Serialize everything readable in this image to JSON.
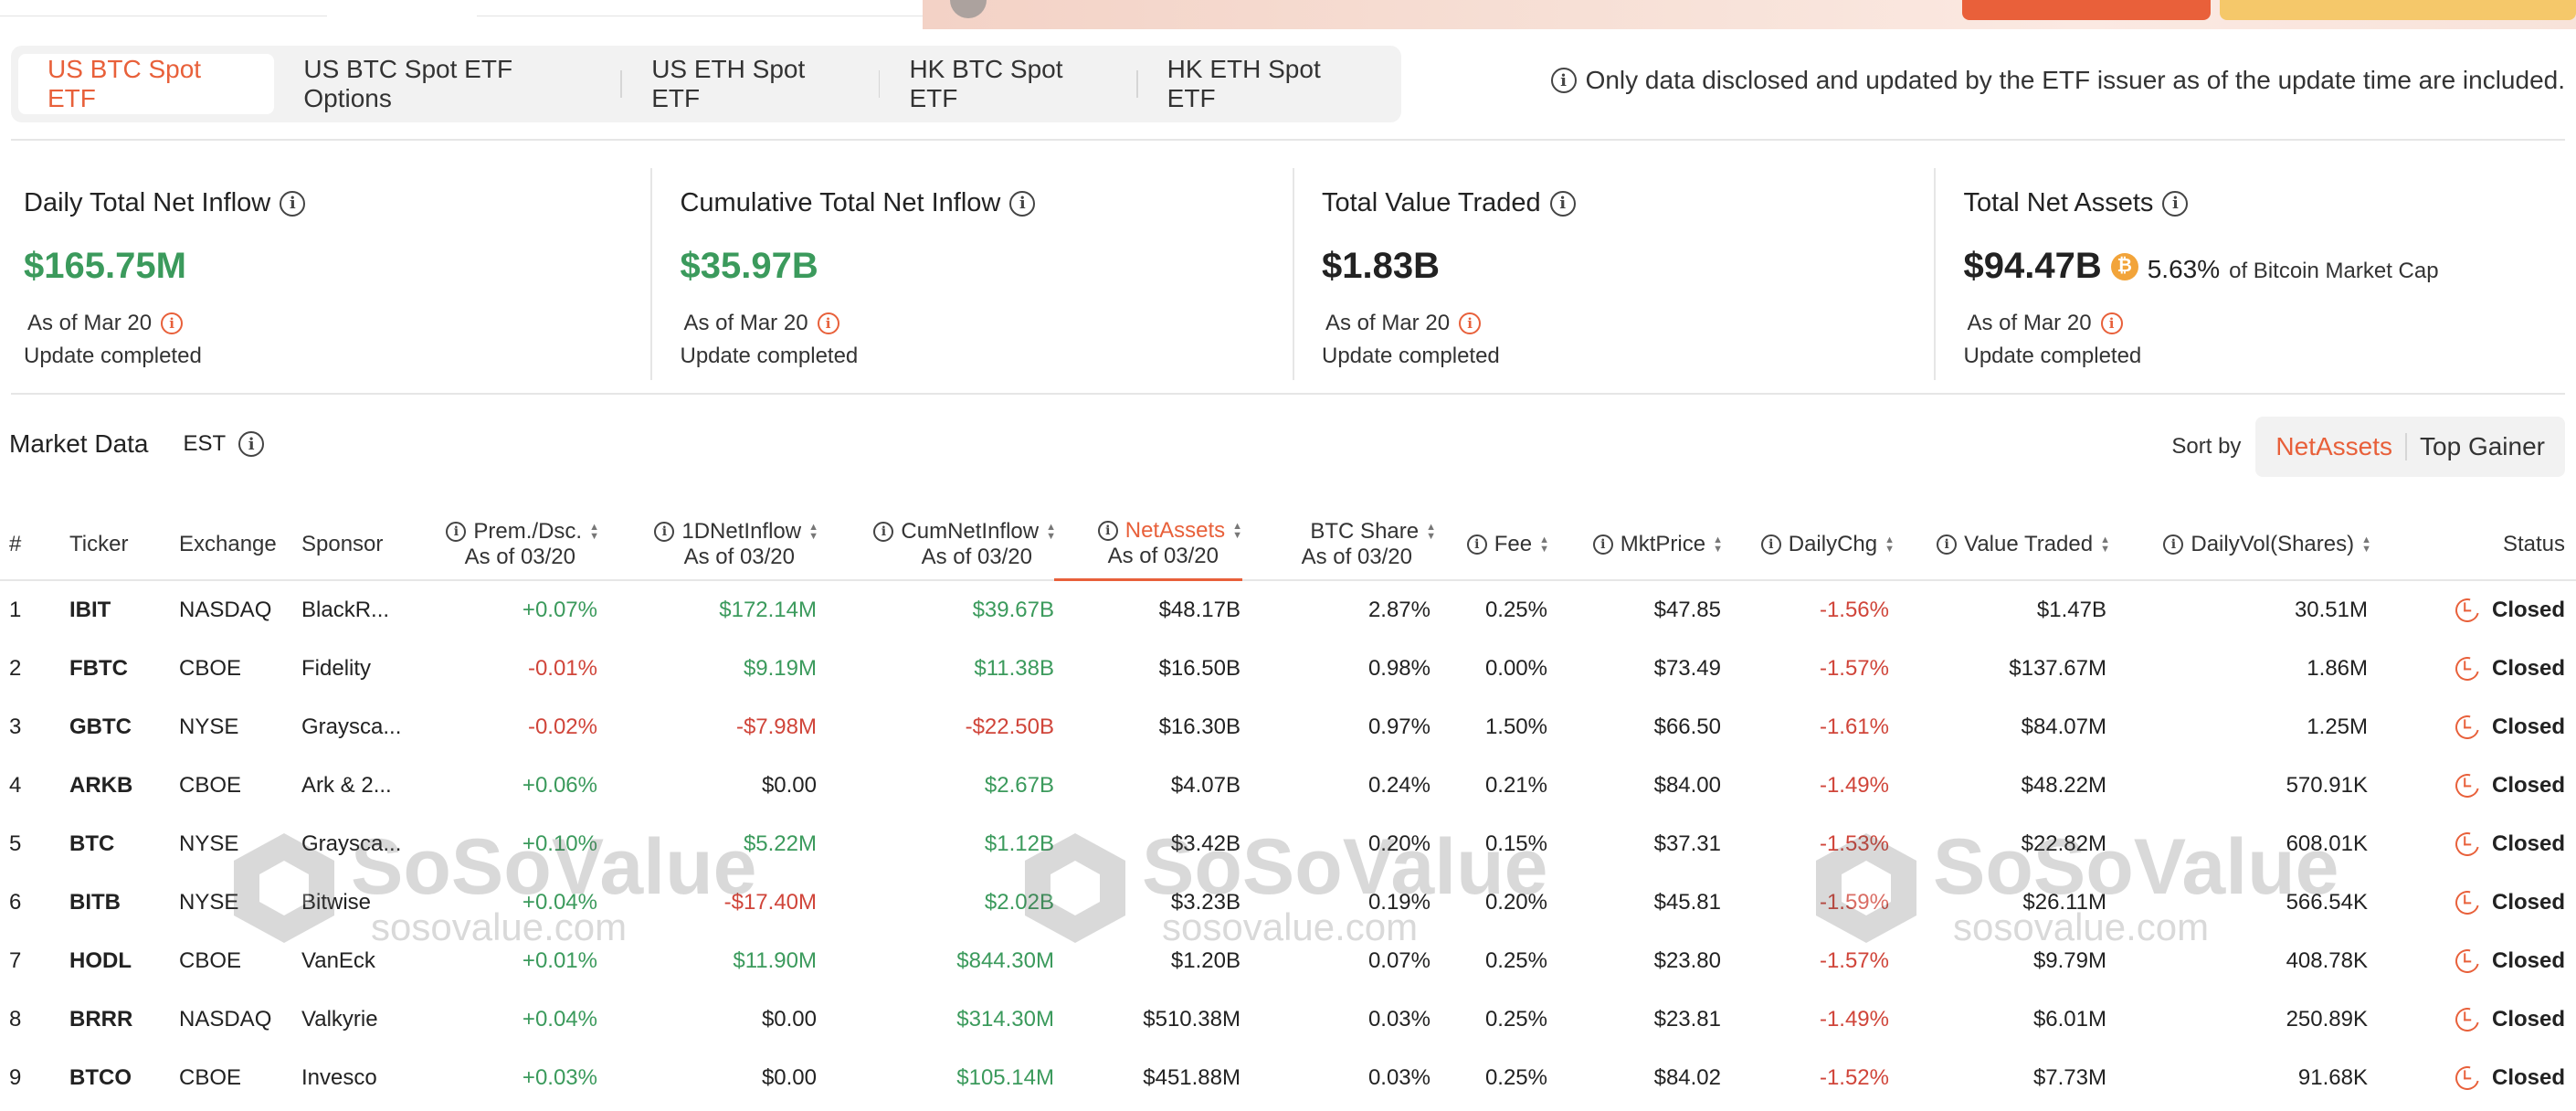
{
  "tabs": [
    {
      "label": "US BTC Spot ETF",
      "active": true
    },
    {
      "label": "US BTC Spot ETF Options",
      "active": false
    },
    {
      "label": "US ETH Spot ETF",
      "active": false
    },
    {
      "label": "HK BTC Spot ETF",
      "active": false
    },
    {
      "label": "HK ETH Spot ETF",
      "active": false
    }
  ],
  "notice": "Only data disclosed and updated by the ETF issuer as of the update time are included.",
  "cards": [
    {
      "label": "Daily Total Net Inflow",
      "value": "$165.75M",
      "asof": "As of Mar 20",
      "status": "Update completed"
    },
    {
      "label": "Cumulative Total Net Inflow",
      "value": "$35.97B",
      "asof": "As of Mar 20",
      "status": "Update completed"
    },
    {
      "label": "Total Value Traded",
      "value": "$1.83B",
      "asof": "As of Mar 20",
      "status": "Update completed"
    },
    {
      "label": "Total Net Assets",
      "value": "$94.47B",
      "pct": "5.63%",
      "pct_label": "of Bitcoin Market Cap",
      "asof": "As of Mar 20",
      "status": "Update completed"
    }
  ],
  "colors": {
    "accent": "#e8603a",
    "positive": "#3b9a5c",
    "negative": "#d0453a",
    "btc": "#f2a43a"
  },
  "market": {
    "title": "Market Data",
    "timezone": "EST",
    "sort_label": "Sort by",
    "sort_options": [
      "NetAssets",
      "Top Gainer"
    ]
  },
  "watermark": {
    "brand": "SoSoValue",
    "url": "sosovalue.com"
  },
  "table": {
    "headers": {
      "num": "#",
      "ticker": "Ticker",
      "exchange": "Exchange",
      "sponsor": "Sponsor",
      "prem": "Prem./Dsc.",
      "prem_sub": "As of 03/20",
      "inflow": "1DNetInflow",
      "inflow_sub": "As of 03/20",
      "cum": "CumNetInflow",
      "cum_sub": "As of 03/20",
      "assets": "NetAssets",
      "assets_sub": "As of 03/20",
      "share": "BTC Share",
      "share_sub": "As of 03/20",
      "fee": "Fee",
      "price": "MktPrice",
      "chg": "DailyChg",
      "traded": "Value Traded",
      "vol": "DailyVol(Shares)",
      "status": "Status"
    },
    "rows": [
      {
        "num": "1",
        "ticker": "IBIT",
        "exchange": "NASDAQ",
        "sponsor": "BlackR...",
        "prem": "+0.07%",
        "inflow": "$172.14M",
        "cum": "$39.67B",
        "assets": "$48.17B",
        "share": "2.87%",
        "fee": "0.25%",
        "price": "$47.85",
        "chg": "-1.56%",
        "traded": "$1.47B",
        "vol": "30.51M",
        "status": "Closed"
      },
      {
        "num": "2",
        "ticker": "FBTC",
        "exchange": "CBOE",
        "sponsor": "Fidelity",
        "prem": "-0.01%",
        "inflow": "$9.19M",
        "cum": "$11.38B",
        "assets": "$16.50B",
        "share": "0.98%",
        "fee": "0.00%",
        "price": "$73.49",
        "chg": "-1.57%",
        "traded": "$137.67M",
        "vol": "1.86M",
        "status": "Closed"
      },
      {
        "num": "3",
        "ticker": "GBTC",
        "exchange": "NYSE",
        "sponsor": "Graysca...",
        "prem": "-0.02%",
        "inflow": "-$7.98M",
        "cum": "-$22.50B",
        "assets": "$16.30B",
        "share": "0.97%",
        "fee": "1.50%",
        "price": "$66.50",
        "chg": "-1.61%",
        "traded": "$84.07M",
        "vol": "1.25M",
        "status": "Closed"
      },
      {
        "num": "4",
        "ticker": "ARKB",
        "exchange": "CBOE",
        "sponsor": "Ark & 2...",
        "prem": "+0.06%",
        "inflow": "$0.00",
        "cum": "$2.67B",
        "assets": "$4.07B",
        "share": "0.24%",
        "fee": "0.21%",
        "price": "$84.00",
        "chg": "-1.49%",
        "traded": "$48.22M",
        "vol": "570.91K",
        "status": "Closed"
      },
      {
        "num": "5",
        "ticker": "BTC",
        "exchange": "NYSE",
        "sponsor": "Graysca...",
        "prem": "+0.10%",
        "inflow": "$5.22M",
        "cum": "$1.12B",
        "assets": "$3.42B",
        "share": "0.20%",
        "fee": "0.15%",
        "price": "$37.31",
        "chg": "-1.53%",
        "traded": "$22.82M",
        "vol": "608.01K",
        "status": "Closed"
      },
      {
        "num": "6",
        "ticker": "BITB",
        "exchange": "NYSE",
        "sponsor": "Bitwise",
        "prem": "+0.04%",
        "inflow": "-$17.40M",
        "cum": "$2.02B",
        "assets": "$3.23B",
        "share": "0.19%",
        "fee": "0.20%",
        "price": "$45.81",
        "chg": "-1.59%",
        "traded": "$26.11M",
        "vol": "566.54K",
        "status": "Closed"
      },
      {
        "num": "7",
        "ticker": "HODL",
        "exchange": "CBOE",
        "sponsor": "VanEck",
        "prem": "+0.01%",
        "inflow": "$11.90M",
        "cum": "$844.30M",
        "assets": "$1.20B",
        "share": "0.07%",
        "fee": "0.25%",
        "price": "$23.80",
        "chg": "-1.57%",
        "traded": "$9.79M",
        "vol": "408.78K",
        "status": "Closed"
      },
      {
        "num": "8",
        "ticker": "BRRR",
        "exchange": "NASDAQ",
        "sponsor": "Valkyrie",
        "prem": "+0.04%",
        "inflow": "$0.00",
        "cum": "$314.30M",
        "assets": "$510.38M",
        "share": "0.03%",
        "fee": "0.25%",
        "price": "$23.81",
        "chg": "-1.49%",
        "traded": "$6.01M",
        "vol": "250.89K",
        "status": "Closed"
      },
      {
        "num": "9",
        "ticker": "BTCO",
        "exchange": "CBOE",
        "sponsor": "Invesco",
        "prem": "+0.03%",
        "inflow": "$0.00",
        "cum": "$105.14M",
        "assets": "$451.88M",
        "share": "0.03%",
        "fee": "0.25%",
        "price": "$84.02",
        "chg": "-1.52%",
        "traded": "$7.73M",
        "vol": "91.68K",
        "status": "Closed"
      }
    ]
  }
}
